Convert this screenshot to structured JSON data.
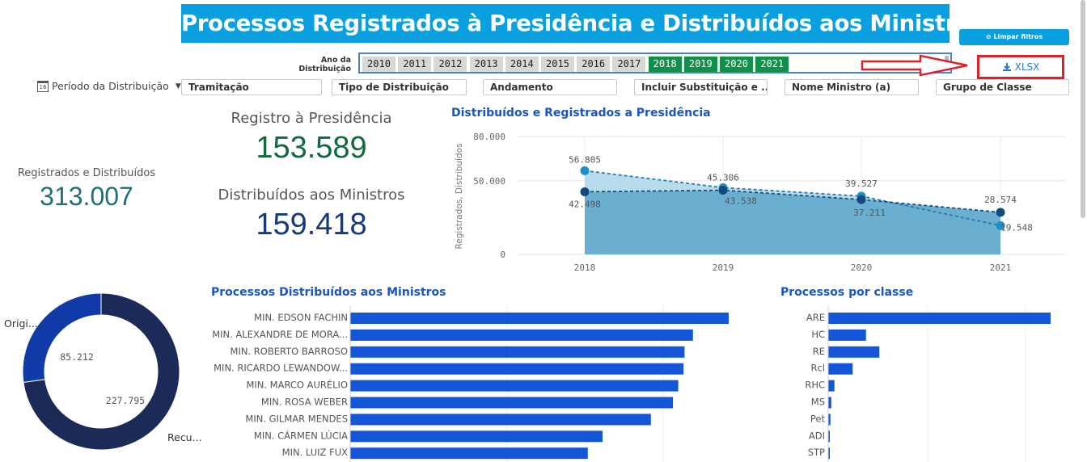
{
  "header": {
    "title": "Processos Registrados à Presidência e Distribuídos aos Ministros",
    "clear_filters_label": "Limpar filtros",
    "xlsx_label": "XLSX"
  },
  "year_filter": {
    "label": "Ano da Distribuição",
    "years": [
      {
        "label": "2010",
        "selected": false
      },
      {
        "label": "2011",
        "selected": false
      },
      {
        "label": "2012",
        "selected": false
      },
      {
        "label": "2013",
        "selected": false
      },
      {
        "label": "2014",
        "selected": false
      },
      {
        "label": "2015",
        "selected": false
      },
      {
        "label": "2016",
        "selected": false
      },
      {
        "label": "2017",
        "selected": false
      },
      {
        "label": "2018",
        "selected": true
      },
      {
        "label": "2019",
        "selected": true
      },
      {
        "label": "2020",
        "selected": true
      },
      {
        "label": "2021",
        "selected": true
      }
    ]
  },
  "filters": {
    "period_label": "Período da Distribuição",
    "items": [
      "Tramitação",
      "Tipo de Distribuição",
      "Andamento",
      "Incluir Substituição e ...",
      "Nome Ministro (a)",
      "Grupo de Classe"
    ]
  },
  "kpis": {
    "total_label": "Registrados e Distribuídos",
    "total_value": "313.007",
    "registro_label": "Registro à Presidência",
    "registro_value": "153.589",
    "distribuidos_label": "Distribuídos aos Ministros",
    "distribuidos_value": "159.418"
  },
  "colors": {
    "accent": "#0aa0e0",
    "selected_year": "#109048",
    "registro_kpi": "#0f6b3e",
    "distribuidos_kpi": "#173a78",
    "total_kpi": "#1f6f78",
    "bar": "#1456d8",
    "donut_dark": "#1c2a58",
    "donut_blue": "#0f3aa8",
    "area_light": "#b7dcec",
    "area_dark": "#6aaed0"
  },
  "line_chart": {
    "title": "Distribuídos e Registrados a Presidência",
    "ylabel": "Registrados, Distribuídos",
    "yticks": [
      "80.000",
      "50.000",
      "0"
    ],
    "chart_data": {
      "type": "area",
      "x": [
        "2018",
        "2019",
        "2020",
        "2021"
      ],
      "ylim": [
        0,
        80000
      ],
      "series": [
        {
          "values": [
            56805,
            45306,
            39527,
            19548
          ],
          "labels": [
            "56.805",
            "45.306",
            "39.527",
            "19.548"
          ]
        },
        {
          "values": [
            42498,
            43538,
            37211,
            28574
          ],
          "labels": [
            "42.498",
            "43.538",
            "37.211",
            "28.574"
          ]
        }
      ]
    }
  },
  "ministers_chart": {
    "title": "Processos Distribuídos aos Ministros",
    "chart_data": {
      "type": "bar",
      "categories": [
        "MIN. EDSON FACHIN",
        "MIN. ALEXANDRE DE MORA...",
        "MIN. ROBERTO BARROSO",
        "MIN. RICARDO LEWANDOW...",
        "MIN. MARCO AURÉLIO",
        "MIN. ROSA WEBER",
        "MIN. GILMAR MENDES",
        "MIN. CÁRMEN LÚCIA",
        "MIN. LUIZ FUX"
      ],
      "values": [
        18000,
        16300,
        15900,
        15850,
        15600,
        15350,
        14300,
        12000,
        11300
      ]
    }
  },
  "class_chart": {
    "title": "Processos por classe",
    "chart_data": {
      "type": "bar",
      "categories": [
        "ARE",
        "HC",
        "RE",
        "Rcl",
        "RHC",
        "MS",
        "Pet",
        "ADI",
        "STP"
      ],
      "values": [
        100000,
        17000,
        23000,
        11000,
        2800,
        1400,
        1000,
        700,
        400
      ]
    }
  },
  "donut_chart": {
    "chart_data": {
      "type": "pie",
      "slices": [
        {
          "label": "Origi...",
          "value": 85212,
          "value_label": "85.212"
        },
        {
          "label": "Recu...",
          "value": 227795,
          "value_label": "227.795"
        }
      ]
    }
  }
}
